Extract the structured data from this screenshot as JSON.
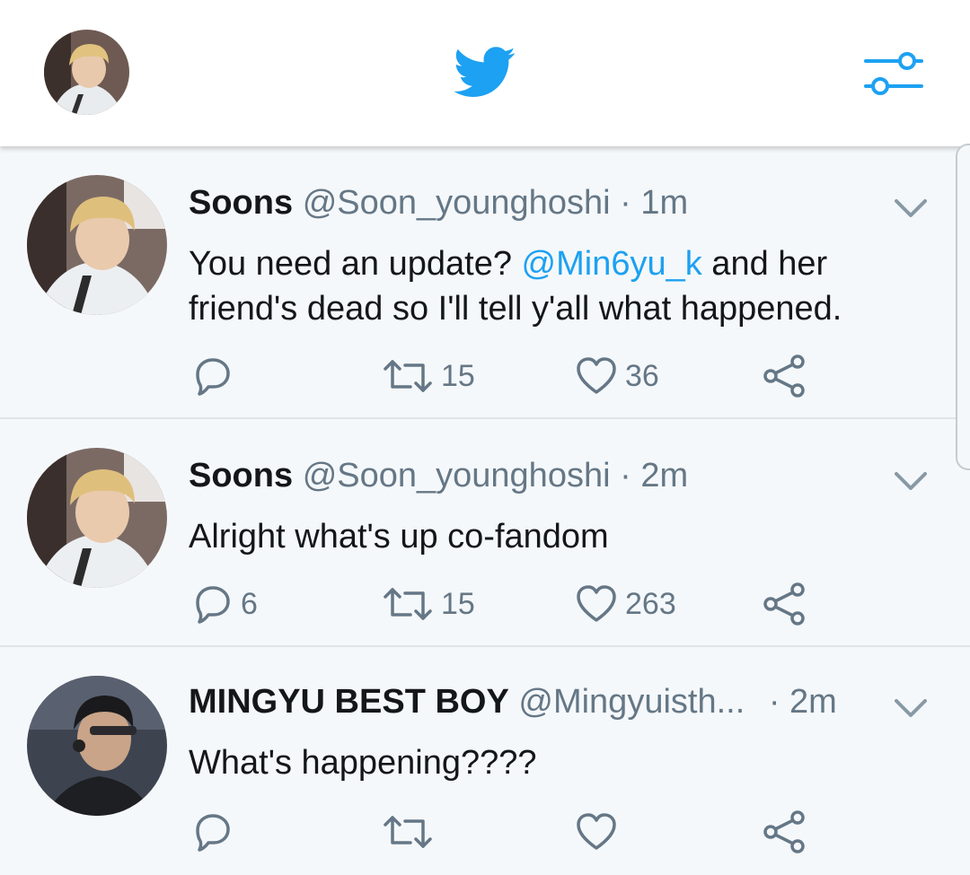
{
  "header": {
    "avatar_icon": "profile-avatar",
    "logo_icon": "twitter-bird-icon",
    "filter_icon": "filter-sliders-icon",
    "accent": "#1da1f2"
  },
  "tweets": [
    {
      "name": "Soons",
      "handle": "@Soon_younghoshi",
      "sep": "·",
      "time": "1m",
      "text_before": "You need an update? ",
      "mention": "@Min6yu_k",
      "text_after": " and her friend's dead so I'll tell y'all what happened.",
      "replies": "",
      "retweets": "15",
      "likes": "36"
    },
    {
      "name": "Soons",
      "handle": "@Soon_younghoshi",
      "sep": "·",
      "time": "2m",
      "text_before": "Alright what's up co-fandom",
      "mention": "",
      "text_after": "",
      "replies": "6",
      "retweets": "15",
      "likes": "263"
    },
    {
      "name": "MINGYU BEST BOY",
      "handle": "@Mingyuisth...",
      "sep": "·",
      "time": "2m",
      "text_before": "What's happening????",
      "mention": "",
      "text_after": "",
      "replies": "",
      "retweets": "",
      "likes": ""
    }
  ],
  "colors": {
    "text": "#14171a",
    "muted": "#657786",
    "link": "#1da1f2",
    "divider": "#dfe4e8",
    "background": "#f5f8fa"
  }
}
